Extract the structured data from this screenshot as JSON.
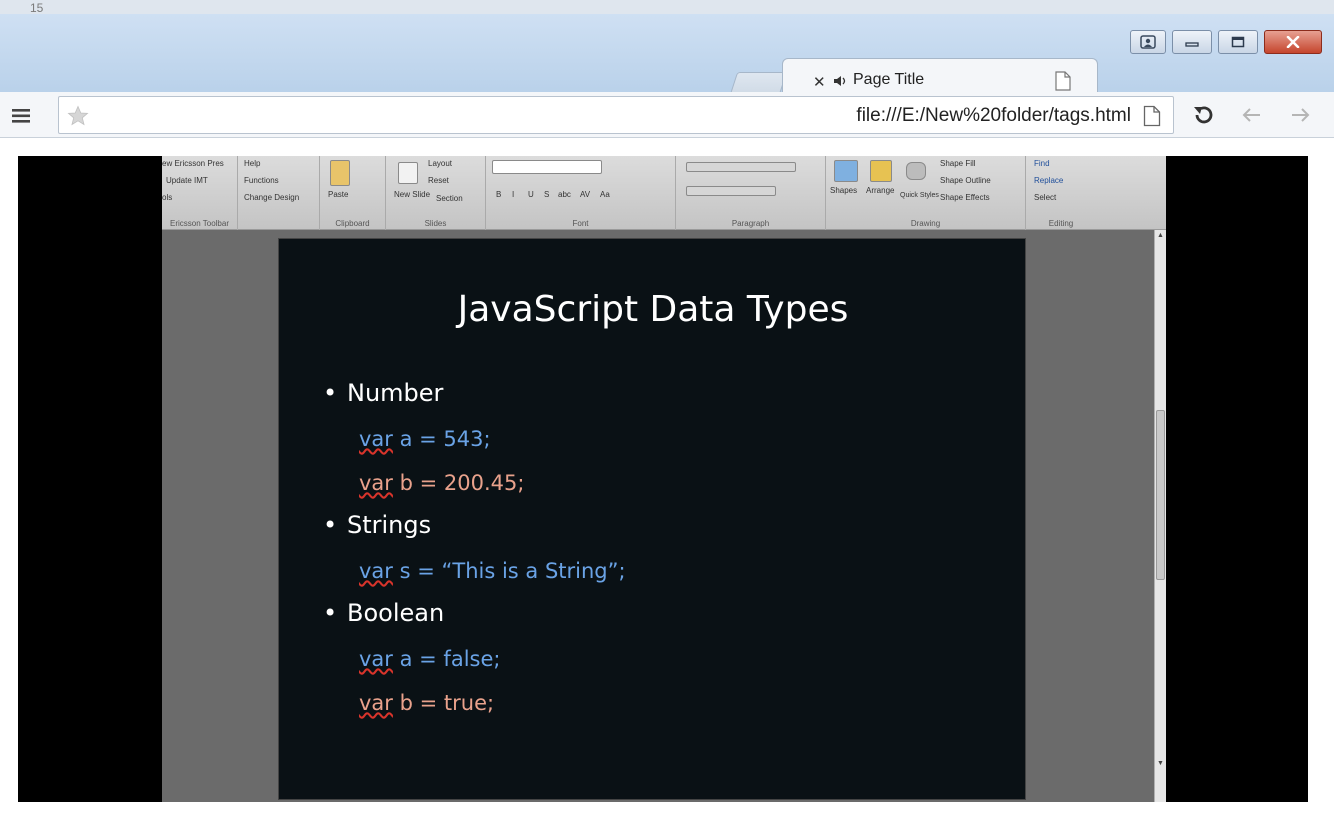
{
  "topstrip": {
    "label": "15"
  },
  "window_controls": {
    "user": "user-icon",
    "minimize": "minimize-icon",
    "maximize": "maximize-icon",
    "close": "close-icon"
  },
  "tab": {
    "title": "Page Title",
    "close_glyph": "✕"
  },
  "address_bar": {
    "url": "file:///E:/New%20folder/tags.html"
  },
  "ribbon": {
    "groups": [
      {
        "label": "Ericsson Toolbar",
        "items": [
          "ew Ericsson Pres",
          "Update IMT",
          "ols"
        ]
      },
      {
        "label": "",
        "items": [
          "Help",
          "Functions",
          "Change Design"
        ]
      },
      {
        "label": "Clipboard",
        "items": [
          "Paste"
        ]
      },
      {
        "label": "Slides",
        "items": [
          "Layout",
          "Reset",
          "New Slide",
          "Section"
        ]
      },
      {
        "label": "Font",
        "items": [
          "B",
          "I",
          "U",
          "S",
          "abc",
          "AV",
          "Aa"
        ]
      },
      {
        "label": "Paragraph",
        "items": []
      },
      {
        "label": "Drawing",
        "items": [
          "Shapes",
          "Arrange",
          "Quick Styles",
          "Shape Fill",
          "Shape Outline",
          "Shape Effects"
        ]
      },
      {
        "label": "Editing",
        "items": [
          "Find",
          "Replace",
          "Select"
        ]
      }
    ]
  },
  "slide": {
    "title": "JavaScript Data Types",
    "sections": [
      {
        "bullet": "Number",
        "lines": [
          {
            "kw": "var",
            "rest": " a = 543;",
            "color": "#6aa3e6"
          },
          {
            "kw": "var",
            "rest": " b = 200.45;",
            "color": "#e9a28c"
          }
        ]
      },
      {
        "bullet": "Strings",
        "lines": [
          {
            "kw": "var",
            "rest": " s = “This is a String”;",
            "color": "#6aa3e6"
          }
        ]
      },
      {
        "bullet": "Boolean",
        "lines": [
          {
            "kw": "var",
            "rest": " a = false;",
            "color": "#6aa3e6"
          },
          {
            "kw": "var",
            "rest": " b = true;",
            "color": "#e9a28c"
          }
        ]
      }
    ]
  }
}
